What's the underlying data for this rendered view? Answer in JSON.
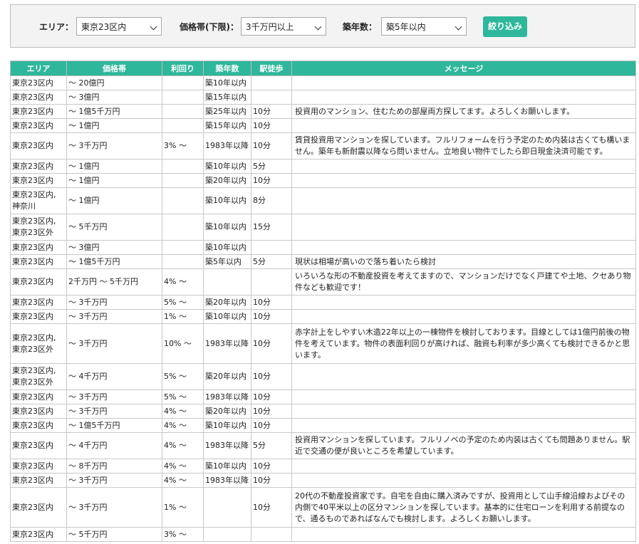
{
  "filters": {
    "area_label": "エリア：",
    "area_value": "東京23区内",
    "price_label": "価格帯(下限)：",
    "price_value": "3千万円以上",
    "age_label": "築年数：",
    "age_value": "築5年以内",
    "submit_label": "絞り込み"
  },
  "table": {
    "headers": [
      "エリア",
      "価格帯",
      "利回り",
      "築年数",
      "駅徒歩",
      "メッセージ"
    ],
    "rows": [
      [
        "東京23区内",
        "～ 20億円",
        "",
        "築10年以内",
        "",
        ""
      ],
      [
        "東京23区内",
        "～ 3億円",
        "",
        "築15年以内",
        "",
        ""
      ],
      [
        "東京23区内",
        "～ 1億5千万円",
        "",
        "築25年以内",
        "10分",
        "投資用のマンション、住むための部屋両方探してます。よろしくお願いします。"
      ],
      [
        "東京23区内",
        "～ 1億円",
        "",
        "築15年以内",
        "10分",
        ""
      ],
      [
        "東京23区内",
        "～ 3千万円",
        "3% ～",
        "1983年以降",
        "10分",
        "賃貸投資用マンションを探しています。フルリフォームを行う予定のため内装は古くても構いません。築年も新耐震以降なら問いません。立地良い物件でしたら即日現金決済可能です。"
      ],
      [
        "東京23区内",
        "～ 1億円",
        "",
        "築10年以内",
        "5分",
        ""
      ],
      [
        "東京23区内",
        "～ 1億円",
        "",
        "築20年以内",
        "10分",
        ""
      ],
      [
        "東京23区内,\n神奈川",
        "～ 1億円",
        "",
        "築10年以内",
        "8分",
        ""
      ],
      [
        "東京23区内,\n東京23区外",
        "～ 5千万円",
        "",
        "築10年以内",
        "15分",
        ""
      ],
      [
        "東京23区内",
        "～ 3億円",
        "",
        "築10年以内",
        "",
        ""
      ],
      [
        "東京23区内",
        "～ 1億5千万円",
        "",
        "築5年以内",
        "5分",
        "現状は相場が高いので落ち着いたら検討"
      ],
      [
        "東京23区内",
        "2千万円 ～ 5千万円",
        "4% ～",
        "",
        "",
        "いろいろな形の不動産投資を考えてますので、マンションだけでなく戸建てや土地、クセあり物件なども歓迎です！"
      ],
      [
        "東京23区内",
        "～ 3千万円",
        "5% ～",
        "築20年以内",
        "10分",
        ""
      ],
      [
        "東京23区内",
        "～ 3千万円",
        "1% ～",
        "築10年以内",
        "10分",
        ""
      ],
      [
        "東京23区内,\n東京23区外",
        "～ 3千万円",
        "10% ～",
        "1983年以降",
        "10分",
        "赤字計上をしやすい木造22年以上の一棟物件を検討しております。目線としては1億円前後の物件を考えています。物件の表面利回りが高ければ、融資も利率が多少高くても検討できるかと思います。"
      ],
      [
        "東京23区内,\n東京23区外",
        "～ 4千万円",
        "5% ～",
        "築20年以内",
        "10分",
        ""
      ],
      [
        "東京23区内",
        "～ 3千万円",
        "5% ～",
        "1983年以降",
        "10分",
        ""
      ],
      [
        "東京23区内",
        "～ 3千万円",
        "4% ～",
        "築20年以内",
        "10分",
        ""
      ],
      [
        "東京23区内",
        "～ 1億5千万円",
        "4% ～",
        "築10年以内",
        "10分",
        ""
      ],
      [
        "東京23区内",
        "～ 4千万円",
        "4% ～",
        "1983年以降",
        "5分",
        "投資用マンションを探しています。フルリノベの予定のため内装は古くても問題ありません。駅近で交通の便が良いところを希望しています。"
      ],
      [
        "東京23区内",
        "～ 8千万円",
        "4% ～",
        "築10年以内",
        "10分",
        ""
      ],
      [
        "東京23区内",
        "～ 3千万円",
        "4% ～",
        "1983年以降",
        "10分",
        ""
      ],
      [
        "東京23区内",
        "～ 3千万円",
        "1% ～",
        "",
        "10分",
        "20代の不動産投資家です。自宅を自由に購入済みですが、投資用として山手線沿線およびその内側で40平米以上の区分マンションを探しています。基本的に住宅ローンを利用する前提なので、通るものであればなんでも検討します。よろしくお願いします。"
      ],
      [
        "東京23区内",
        "～ 5千万円",
        "3% ～",
        "",
        "",
        ""
      ]
    ]
  }
}
